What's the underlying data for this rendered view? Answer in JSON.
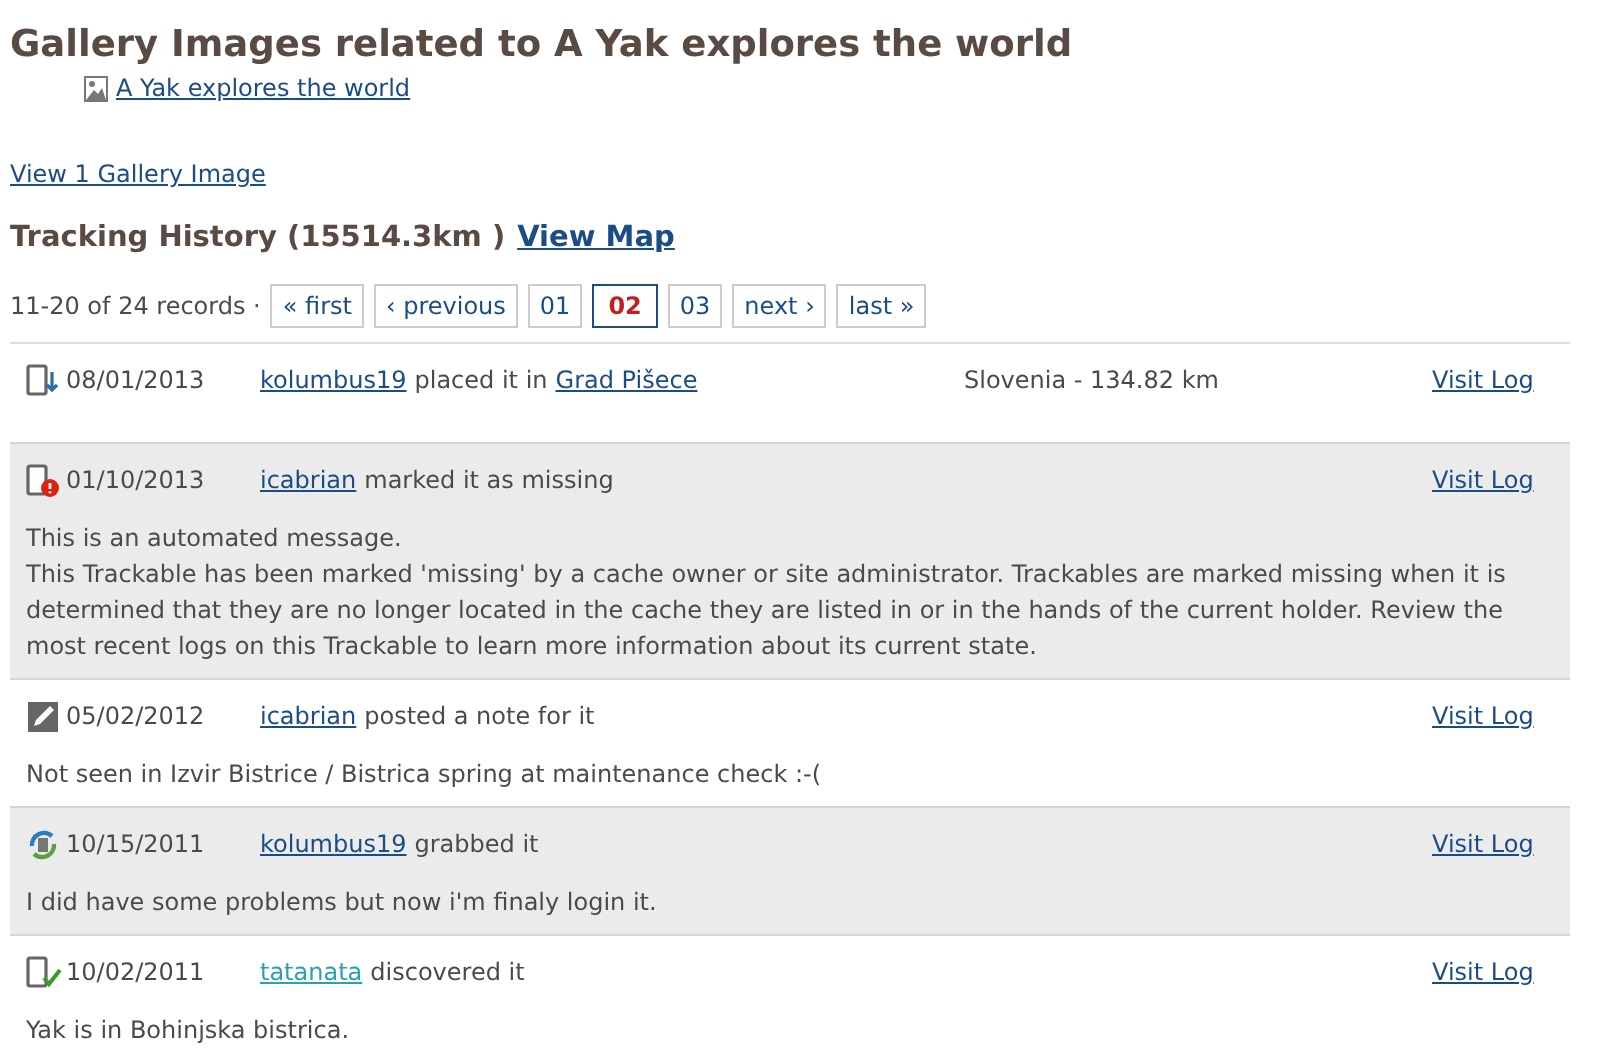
{
  "heading": "Gallery Images related to A Yak explores the world",
  "gallery_link": "A Yak explores the world",
  "view_gallery": "View 1 Gallery Image",
  "tracking": {
    "title": "Tracking History (15514.3km )",
    "map_link": "View Map"
  },
  "pager": {
    "summary": "11-20 of 24 records ·",
    "pages": [
      {
        "label": "« first",
        "selected": false
      },
      {
        "label": "‹ previous",
        "selected": false
      },
      {
        "label": "01",
        "selected": false
      },
      {
        "label": "02",
        "selected": true
      },
      {
        "label": "03",
        "selected": false
      },
      {
        "label": "next ›",
        "selected": false
      },
      {
        "label": "last »",
        "selected": false
      }
    ]
  },
  "logs": [
    {
      "kind": "placed",
      "date": "08/01/2013",
      "user": {
        "name": "kolumbus19",
        "color": "#1a4c86"
      },
      "action": "placed it in",
      "place": "Grad Pišece",
      "location": "Slovenia - 134.82 km",
      "link": "Visit Log"
    },
    {
      "kind": "missing",
      "date": "01/10/2013",
      "user": {
        "name": "icabrian",
        "color": "#1a4c86"
      },
      "action": "marked it as missing",
      "link": "Visit Log",
      "message": [
        "This is an automated message.",
        "This Trackable has been marked 'missing' by a cache owner or site administrator. Trackables are marked missing when it is determined that they are no longer located in the cache they are listed in or in the hands of the current holder. Review the most recent logs on this Trackable to learn more information about its current state."
      ]
    },
    {
      "kind": "note",
      "date": "05/02/2012",
      "user": {
        "name": "icabrian",
        "color": "#1a4c86"
      },
      "action": "posted a note for it",
      "link": "Visit Log",
      "message": [
        "Not seen in Izvir Bistrice / Bistrica spring at maintenance check :-("
      ]
    },
    {
      "kind": "grabbed",
      "date": "10/15/2011",
      "user": {
        "name": "kolumbus19",
        "color": "#1a4c86"
      },
      "action": "grabbed it",
      "link": "Visit Log",
      "message": [
        "I did have some problems but now i'm finaly login it."
      ]
    },
    {
      "kind": "discovered",
      "date": "10/02/2011",
      "user": {
        "name": "tatanata",
        "color": "#2aa0b0"
      },
      "action": "discovered it",
      "link": "Visit Log",
      "message": [
        "Yak is in Bohinjska bistrica."
      ]
    }
  ]
}
